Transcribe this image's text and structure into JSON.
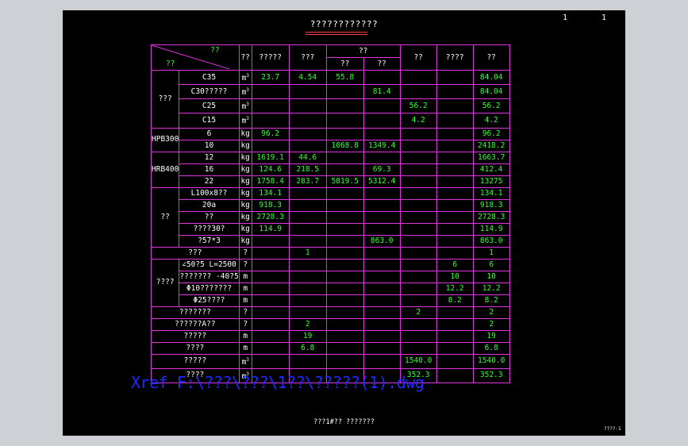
{
  "page": {
    "page_left": "1",
    "page_right": "1",
    "title": "????????????",
    "footer": "???1#?? ???????",
    "corner_tag": "????-1",
    "xref": "Xref F:\\???\\???\\1??\\?????(1).dwg"
  },
  "header": {
    "diag_top": "??",
    "diag_bottom": "??",
    "unit": "??",
    "c1": "?????",
    "c2": "???",
    "grp": "??",
    "g1": "??",
    "g2": "??",
    "c5": "??",
    "c6": "????",
    "total": "??"
  },
  "rows": [
    {
      "cat": "???",
      "item": "C35",
      "unit": "m3",
      "v": [
        "23.7",
        "4.54",
        "55.8",
        "",
        "",
        ""
      ],
      "total": "84.04"
    },
    {
      "cat": "",
      "item": "C30?????",
      "unit": "m3",
      "v": [
        "",
        "",
        "",
        "81.4",
        "",
        ""
      ],
      "total": "84.04"
    },
    {
      "cat": "",
      "item": "C25",
      "unit": "m3",
      "v": [
        "",
        "",
        "",
        "",
        "56.2",
        ""
      ],
      "total": "56.2"
    },
    {
      "cat": "",
      "item": "C15",
      "unit": "m3",
      "v": [
        "",
        "",
        "",
        "",
        "4.2",
        ""
      ],
      "total": "4.2"
    },
    {
      "cat": "HPB300",
      "item": "6",
      "unit": "kg",
      "v": [
        "96.2",
        "",
        "",
        "",
        "",
        ""
      ],
      "total": "96.2"
    },
    {
      "cat": "",
      "item": "10",
      "unit": "kg",
      "v": [
        "",
        "",
        "1068.8",
        "1349.4",
        "",
        ""
      ],
      "total": "2418.2"
    },
    {
      "cat": "HRB400",
      "item": "12",
      "unit": "kg",
      "v": [
        "1619.1",
        "44.6",
        "",
        "",
        "",
        ""
      ],
      "total": "1663.7"
    },
    {
      "cat": "",
      "item": "16",
      "unit": "kg",
      "v": [
        "124.6",
        "218.5",
        "",
        "69.3",
        "",
        ""
      ],
      "total": "412.4"
    },
    {
      "cat": "",
      "item": "22",
      "unit": "kg",
      "v": [
        "1758.4",
        "283.7",
        "5819.5",
        "5312.4",
        "",
        ""
      ],
      "total": "13275"
    },
    {
      "cat": "??",
      "item": "L100x8??",
      "unit": "kg",
      "v": [
        "134.1",
        "",
        "",
        "",
        "",
        ""
      ],
      "total": "134.1"
    },
    {
      "cat": "",
      "item": "20a",
      "unit": "kg",
      "v": [
        "918.3",
        "",
        "",
        "",
        "",
        ""
      ],
      "total": "918.3"
    },
    {
      "cat": "",
      "item": "??",
      "unit": "kg",
      "v": [
        "2728.3",
        "",
        "",
        "",
        "",
        ""
      ],
      "total": "2728.3"
    },
    {
      "cat": "",
      "item": "????30?",
      "unit": "kg",
      "v": [
        "114.9",
        "",
        "",
        "",
        "",
        ""
      ],
      "total": "114.9"
    },
    {
      "cat": "",
      "item": "?57*3",
      "unit": "kg",
      "v": [
        "",
        "",
        "",
        "863.0",
        "",
        ""
      ],
      "total": "863.0"
    },
    {
      "cat": "???",
      "item": "",
      "unit": "?",
      "v": [
        "",
        "1",
        "",
        "",
        "",
        ""
      ],
      "total": "1"
    },
    {
      "cat": "????",
      "item": "∠50?5  L=2500",
      "unit": "?",
      "v": [
        "",
        "",
        "",
        "",
        "",
        "6"
      ],
      "total": "6"
    },
    {
      "cat": "",
      "item": "??????? -40?5",
      "unit": "m",
      "v": [
        "",
        "",
        "",
        "",
        "",
        "10"
      ],
      "total": "10"
    },
    {
      "cat": "",
      "item": "Φ10???????",
      "unit": "m",
      "v": [
        "",
        "",
        "",
        "",
        "",
        "12.2"
      ],
      "total": "12.2"
    },
    {
      "cat": "",
      "item": "Φ25????",
      "unit": "m",
      "v": [
        "",
        "",
        "",
        "",
        "",
        "8.2"
      ],
      "total": "8.2"
    },
    {
      "cat": "???????",
      "item": "",
      "unit": "?",
      "v": [
        "",
        "",
        "",
        "",
        "2",
        ""
      ],
      "total": "2"
    },
    {
      "cat": "??????A??",
      "item": "",
      "unit": "?",
      "v": [
        "",
        "2",
        "",
        "",
        "",
        ""
      ],
      "total": "2"
    },
    {
      "cat": "?????",
      "item": "",
      "unit": "m",
      "v": [
        "",
        "19",
        "",
        "",
        "",
        ""
      ],
      "total": "19"
    },
    {
      "cat": "????",
      "item": "",
      "unit": "m",
      "v": [
        "",
        "6.8",
        "",
        "",
        "",
        ""
      ],
      "total": "6.8"
    },
    {
      "cat": "?????",
      "item": "",
      "unit": "m3",
      "v": [
        "",
        "",
        "",
        "",
        "1540.0",
        ""
      ],
      "total": "1540.0"
    },
    {
      "cat": "????",
      "item": "",
      "unit": "m3",
      "v": [
        "",
        "",
        "",
        "",
        "352.3",
        ""
      ],
      "total": "352.3"
    }
  ],
  "colors": {
    "grid": "#e033e0",
    "value": "#33ff33",
    "unit": "#ffffff",
    "xref": "#1c2cff",
    "viewport": "#000000",
    "frame": "#cdd1d6"
  }
}
